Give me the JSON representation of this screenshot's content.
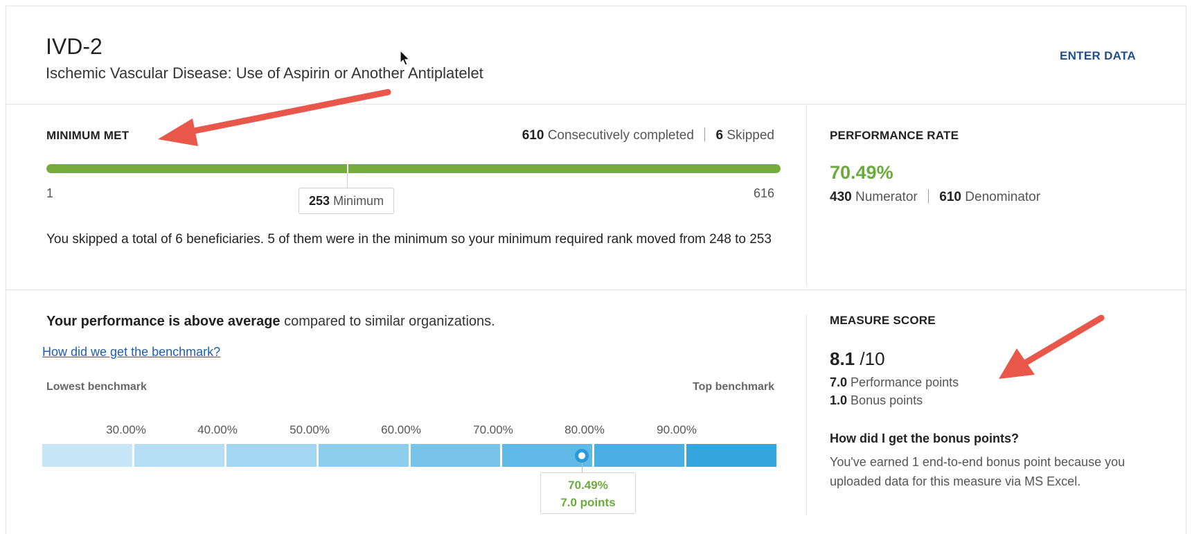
{
  "header": {
    "code": "IVD-2",
    "title": "Ischemic Vascular Disease: Use of Aspirin or Another Antiplatelet",
    "enter_data": "ENTER DATA"
  },
  "minimum": {
    "label": "MINIMUM MET",
    "completed_count": "610",
    "completed_label": "Consecutively completed",
    "skipped_count": "6",
    "skipped_label": "Skipped",
    "range_start": "1",
    "range_end": "616",
    "progress_fraction": 1.0,
    "minimum_rank": "253",
    "minimum_rank_value": 253,
    "range_end_value": 616,
    "minimum_label": "Minimum",
    "skip_note": "You skipped a total of 6 beneficiaries. 5 of them were in the minimum so your minimum required rank moved from 248 to 253",
    "bar_color": "#76ac3c"
  },
  "performance": {
    "label": "PERFORMANCE RATE",
    "rate": "70.49%",
    "numerator": "430",
    "numerator_label": "Numerator",
    "denominator": "610",
    "denominator_label": "Denominator",
    "rate_color": "#6aab3c"
  },
  "benchmark": {
    "summary_bold": "Your performance is above average",
    "summary_rest": " compared to similar organizations.",
    "link": "How did we get the benchmark?",
    "lowest_label": "Lowest benchmark",
    "top_label": "Top benchmark",
    "ticks": [
      "30.00%",
      "40.00%",
      "50.00%",
      "60.00%",
      "70.00%",
      "80.00%",
      "90.00%"
    ],
    "segment_count": 8,
    "marker_position_fraction": 0.735,
    "marker_rate": "70.49%",
    "marker_points": "7.0 points",
    "segment_colors": [
      "#c7e6f7",
      "#b5def4",
      "#a2d6f1",
      "#8dcdee",
      "#77c3ea",
      "#61b9e7",
      "#4bafe3",
      "#34a5df"
    ]
  },
  "measure_score": {
    "label": "MEASURE SCORE",
    "score": "8.1",
    "max": "/10",
    "performance_points": "7.0",
    "performance_label": "Performance points",
    "bonus_points": "1.0",
    "bonus_label": "Bonus points",
    "bonus_question": "How did I get the bonus points?",
    "bonus_explanation": "You've earned 1 end-to-end bonus point because you uploaded data for this measure via MS Excel."
  },
  "annotations": {
    "arrow_color": "#e8574a"
  }
}
